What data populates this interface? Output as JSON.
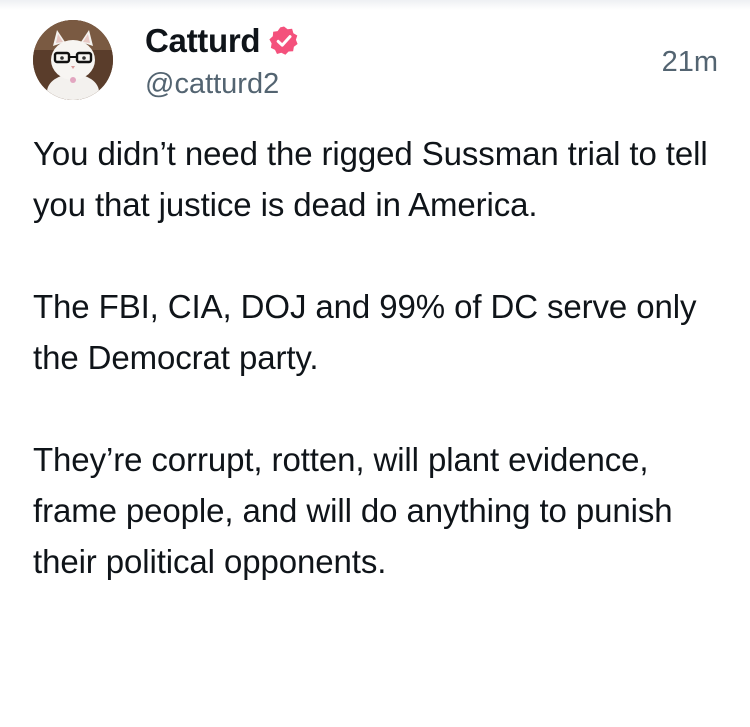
{
  "author": {
    "display_name": "Catturd",
    "handle": "@catturd2",
    "verified": true,
    "avatar_icon": "cat-with-glasses-avatar",
    "verified_icon": "verified-badge-icon",
    "verified_color": "#f4517c"
  },
  "post": {
    "timestamp": "21m",
    "paragraphs": [
      "You didn’t need the rigged Sussman trial to tell you that justice is dead in America.",
      "The FBI, CIA, DOJ and 99% of DC serve only the Democrat party.",
      "They’re corrupt, rotten, will plant evidence, frame people, and will do anything to punish their political opponents."
    ]
  },
  "colors": {
    "text": "#0f1419",
    "secondary": "#536471",
    "background": "#ffffff"
  }
}
